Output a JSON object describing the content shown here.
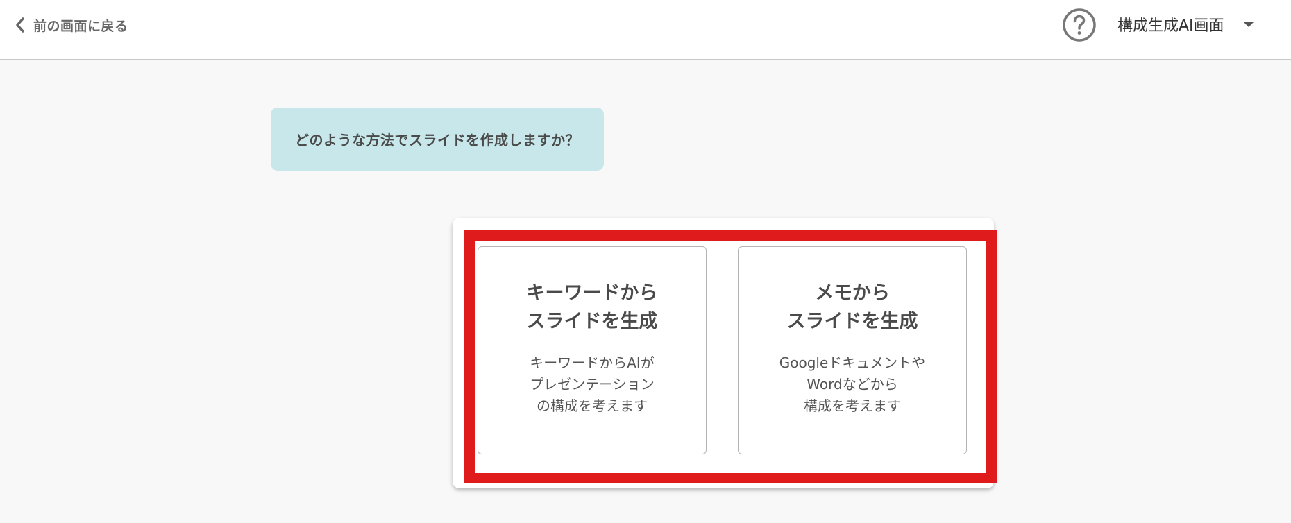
{
  "header": {
    "back_label": "前の画面に戻る",
    "mode_select_value": "構成生成AI画面"
  },
  "icons": {
    "back": "chevron-left-icon",
    "help": "question-circle-icon",
    "dropdown": "caret-down-icon"
  },
  "prompt": {
    "question": "どのような方法でスライドを作成しますか？"
  },
  "options": [
    {
      "title": "キーワードから\nスライドを生成",
      "description": "キーワードからAIが\nプレゼンテーション\nの構成を考えます"
    },
    {
      "title": "メモから\nスライドを生成",
      "description": "Googleドキュメントや\nWordなどから\n構成を考えます"
    }
  ],
  "colors": {
    "bubble_bg": "#c7e7ea",
    "highlight": "#e01b1b",
    "page_bg": "#f8f8f8"
  }
}
